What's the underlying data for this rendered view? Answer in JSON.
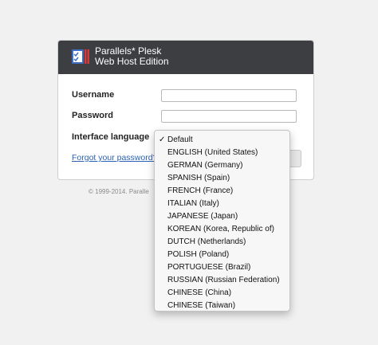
{
  "header": {
    "brand_line1": "Parallels* Plesk",
    "brand_line2": "Web Host Edition"
  },
  "form": {
    "username_label": "Username",
    "password_label": "Password",
    "language_label": "Interface language",
    "forgot_link": "Forgot your password?",
    "username_value": "",
    "password_value": ""
  },
  "footer": {
    "copyright": "© 1999-2014. Paralle"
  },
  "language_dropdown": {
    "selected": "Default",
    "options": [
      "Default",
      "ENGLISH (United States)",
      "GERMAN (Germany)",
      "SPANISH (Spain)",
      "FRENCH (France)",
      "ITALIAN (Italy)",
      "JAPANESE (Japan)",
      "KOREAN (Korea, Republic of)",
      "DUTCH (Netherlands)",
      "POLISH (Poland)",
      "PORTUGUESE (Brazil)",
      "RUSSIAN (Russian Federation)",
      "CHINESE (China)",
      "CHINESE (Taiwan)"
    ],
    "check_mark": "✓"
  },
  "colors": {
    "header_bg": "#3c3e42",
    "link": "#2a62b5",
    "logo_blue": "#3d6fc6",
    "logo_red": "#d43a3a"
  }
}
